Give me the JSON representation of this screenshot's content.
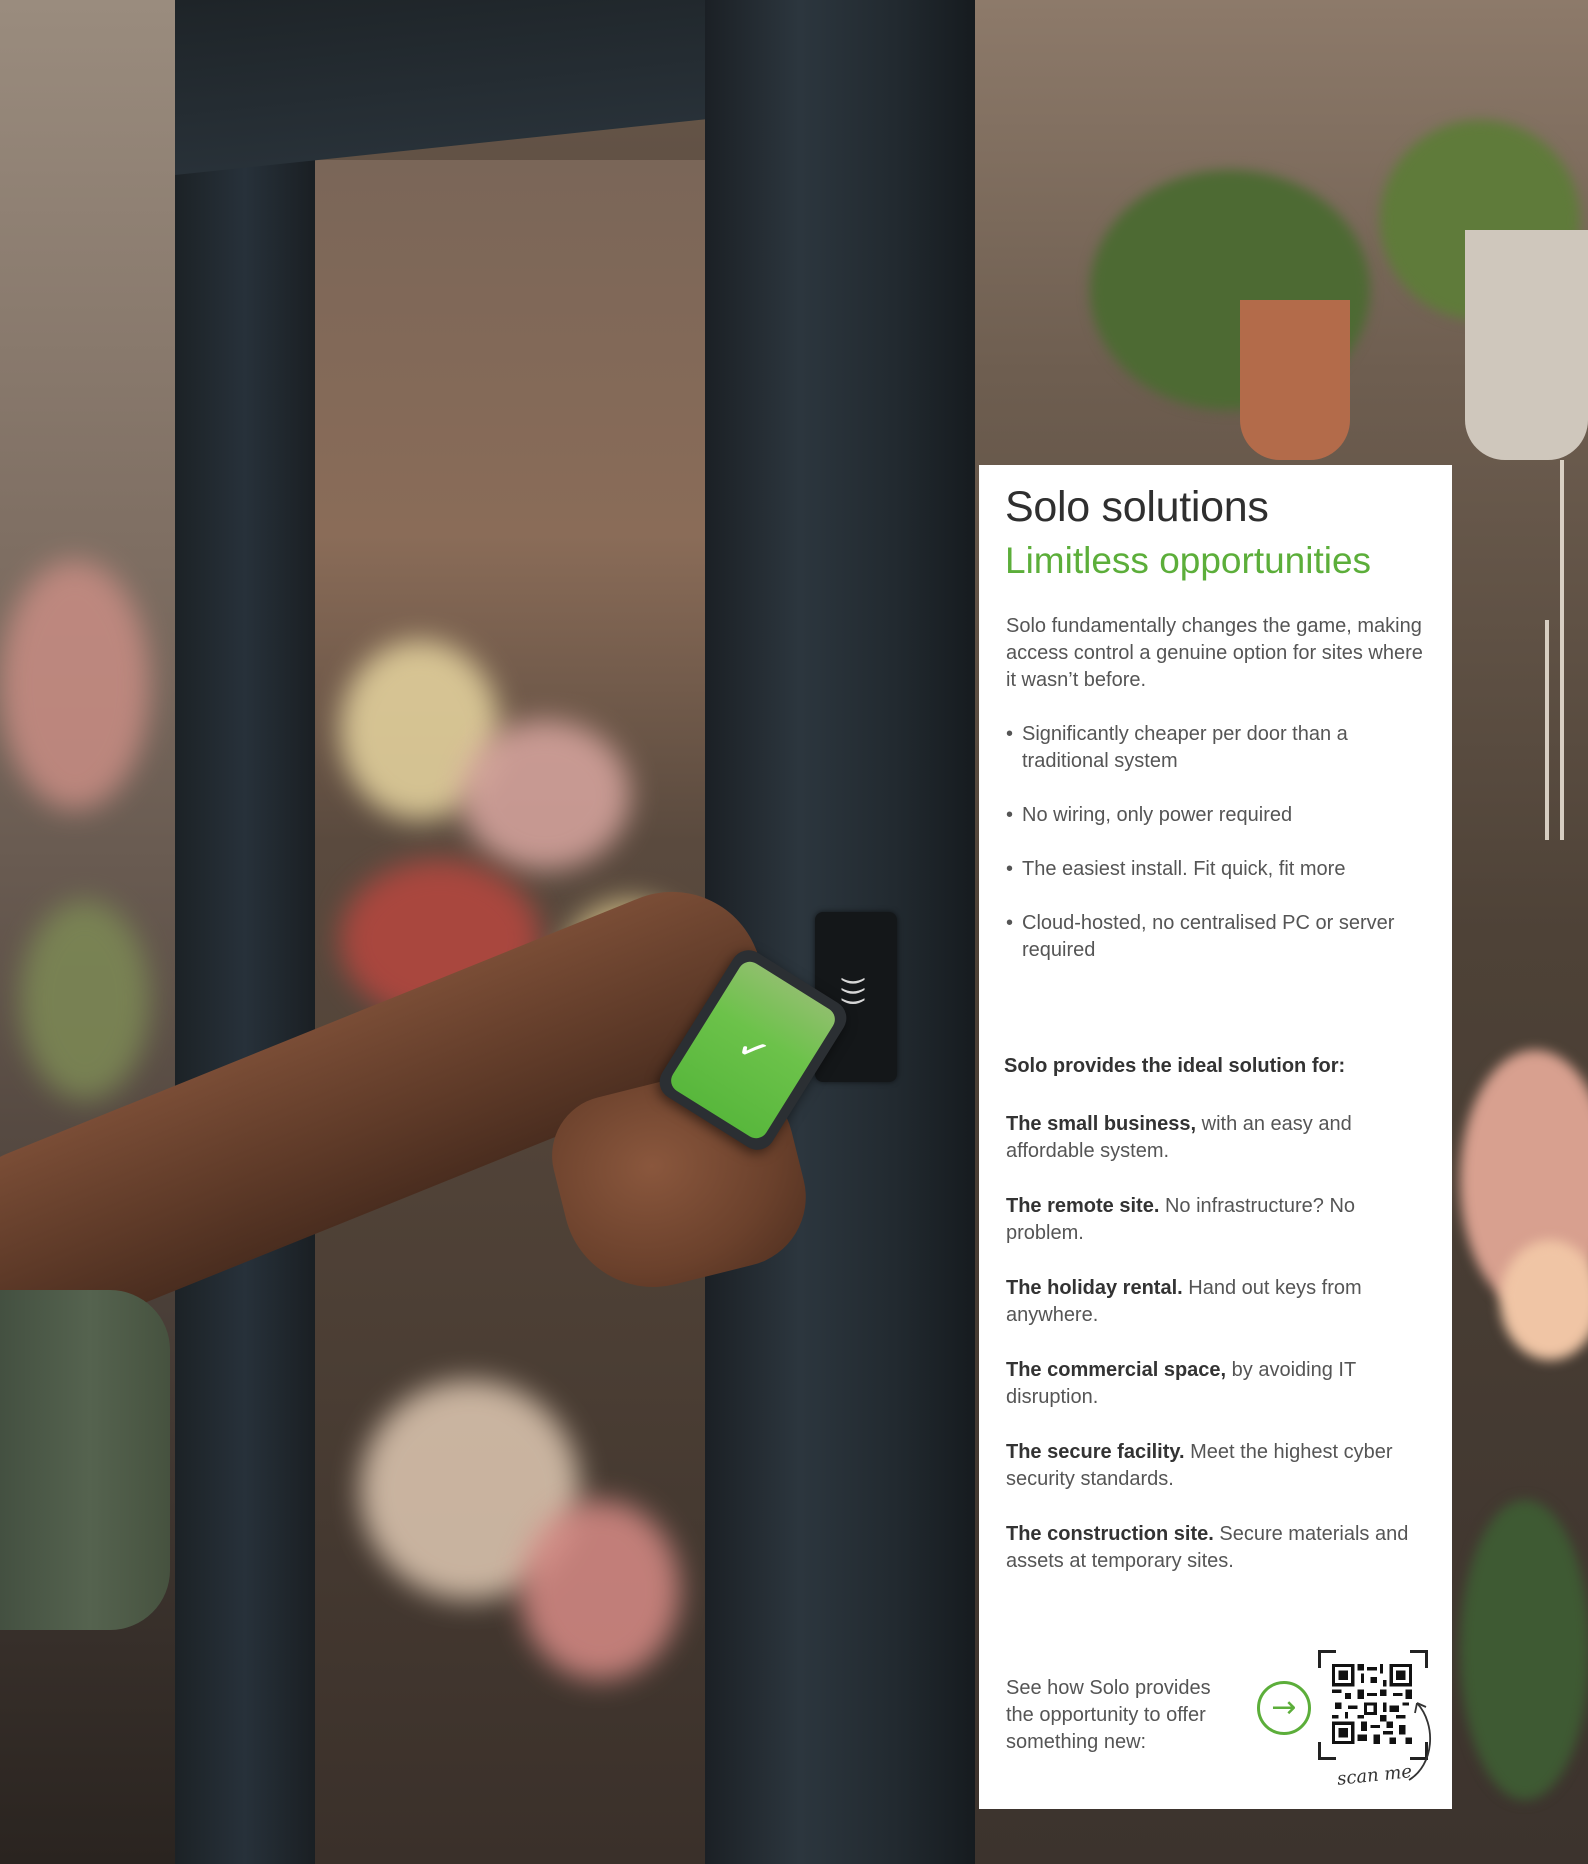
{
  "panel": {
    "title": "Solo solutions",
    "subtitle": "Limitless opportunities",
    "intro": "Solo fundamentally changes the game, making access control a genuine option for sites where it wasn’t before.",
    "features": [
      "Significantly cheaper per door than a traditional system",
      "No wiring, only power required",
      "The easiest install. Fit quick, fit more",
      "Cloud-hosted, no centralised PC or server required"
    ],
    "solution_heading": "Solo provides the ideal solution for:",
    "solutions": [
      {
        "bold": "The small business,",
        "text": " with an easy and affordable system."
      },
      {
        "bold": "The remote site.",
        "text": " No infrastructure? No problem."
      },
      {
        "bold": "The holiday rental.",
        "text": " Hand out keys from anywhere."
      },
      {
        "bold": "The commercial space,",
        "text": " by avoiding IT disruption."
      },
      {
        "bold": "The secure facility.",
        "text": " Meet the highest cyber security standards."
      },
      {
        "bold": "The construction site.",
        "text": " Secure materials and assets at temporary sites."
      }
    ],
    "cta_text": "See how Solo provides the opportunity to offer something new:",
    "scan_label": "scan me",
    "arrow_icon": "→",
    "accent_color": "#5cae3a"
  }
}
